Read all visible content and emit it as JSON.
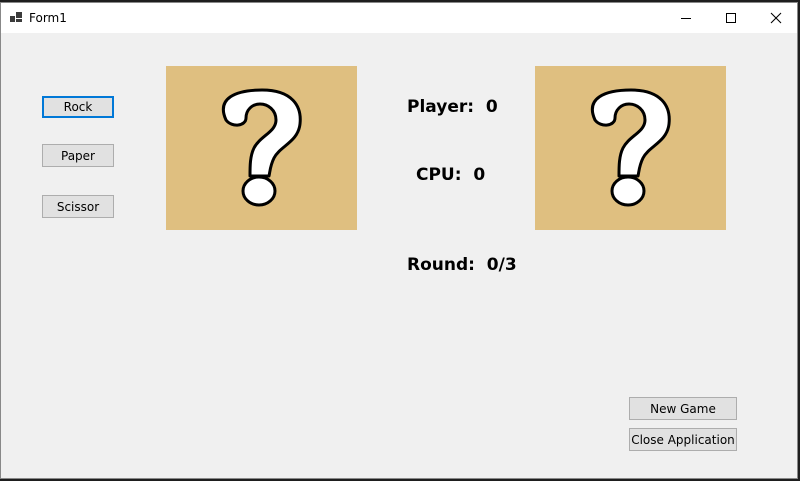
{
  "window": {
    "title": "Form1"
  },
  "buttons": {
    "rock": "Rock",
    "paper": "Paper",
    "scissor": "Scissor",
    "new_game": "New Game",
    "close_app": "Close Application"
  },
  "score": {
    "player_label": "Player:",
    "player_value": "0",
    "cpu_label": "CPU:",
    "cpu_value": "0",
    "round_label": "Round:",
    "round_value": "0/3"
  },
  "images": {
    "player_choice": "question-mark-icon",
    "cpu_choice": "question-mark-icon"
  },
  "colors": {
    "picture_bg": "#dfbf80",
    "focus_border": "#0078d7",
    "form_bg": "#f0f0f0"
  }
}
